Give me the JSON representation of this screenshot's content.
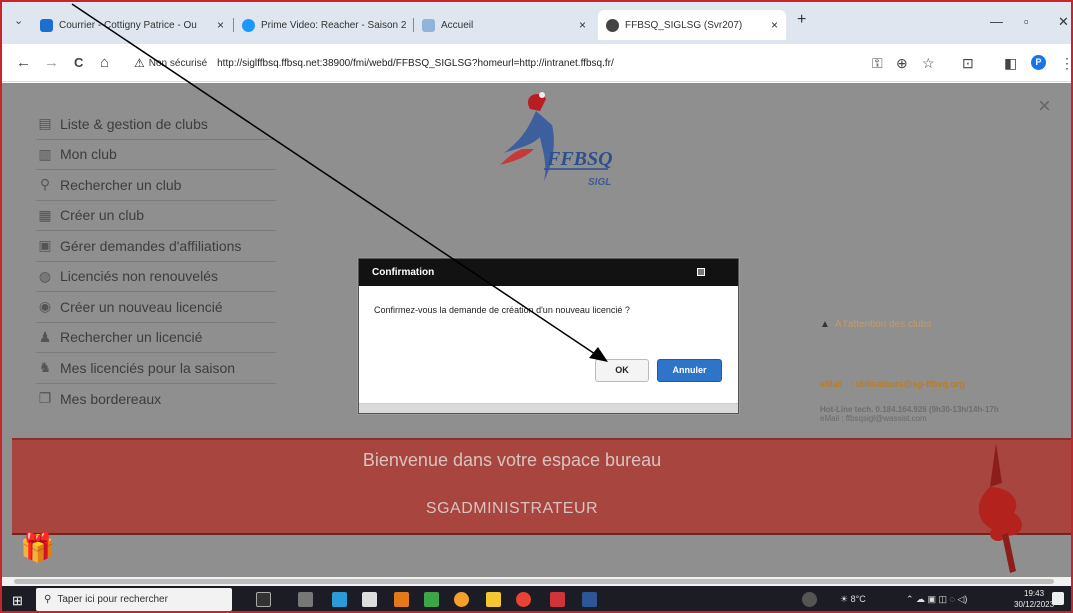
{
  "tabs": [
    {
      "label": "Courrier - Cottigny Patrice - Ou",
      "color": "#1a6fd1"
    },
    {
      "label": "Prime Video: Reacher - Saison 2",
      "color": "#1a98ff"
    },
    {
      "label": "Accueil",
      "color": "#8fb3d9"
    },
    {
      "label": "FFBSQ_SIGLSG (Svr207)",
      "color": "#444444",
      "active": true
    }
  ],
  "tab_close": "×",
  "new_tab": "+",
  "window": {
    "minimize": "—",
    "restore": "▫",
    "close": "✕"
  },
  "address": {
    "security_label": "Non sécurisé",
    "url": "http://siglffbsq.ffbsq.net:38900/fmi/webd/FFBSQ_SIGLSG?homeurl=http://intranet.ffbsq.fr/"
  },
  "nav_icons": {
    "back": "←",
    "forward": "→",
    "reload": "C",
    "home": "⌂",
    "key": "⚿",
    "zoom": "⊕",
    "star": "☆",
    "ext": "⊡",
    "sidebar": "◧",
    "profile": "P",
    "menu": "⋮"
  },
  "menu": [
    {
      "label": "Liste & gestion de clubs",
      "icon": "list-icon"
    },
    {
      "label": "Mon club",
      "icon": "document-icon"
    },
    {
      "label": "Rechercher un club",
      "icon": "search-icon"
    },
    {
      "label": "Créer un club",
      "icon": "document-icon"
    },
    {
      "label": "Gérer demandes d'affiliations",
      "icon": "card-icon"
    },
    {
      "label": "Licenciés non renouvelés",
      "icon": "group-icon"
    },
    {
      "label": "Créer un nouveau licencié",
      "icon": "user-icon"
    },
    {
      "label": "Rechercher un licencié",
      "icon": "user-search-icon"
    },
    {
      "label": "Mes licenciés pour la saison",
      "icon": "users-icon"
    },
    {
      "label": "Mes bordereaux",
      "icon": "copy-icon"
    }
  ],
  "logo": {
    "name": "FFBSQ",
    "sub": "SIGL"
  },
  "page_close": "×",
  "notice": {
    "attention": "A l'attention des clubs",
    "email_label": "eMail",
    "email_value": ": utilisateurs@sg-ffbsq.org",
    "hotline_line1": "Hot-Line tech. 0.184.164.926 (9h30-13h/14h-17h",
    "hotline_line2": "eMail   : ffbsqsigl@wassist.com"
  },
  "banner": {
    "welcome": "Bienvenue dans votre espace bureau",
    "role": "SGADMINISTRATEUR"
  },
  "dialog": {
    "title": "Confirmation",
    "message": "Confirmez-vous la demande de création d'un nouveau licencié ?",
    "ok": "OK",
    "cancel": "Annuler"
  },
  "taskbar": {
    "search_placeholder": "Taper ici pour rechercher",
    "temperature": "8°C",
    "time": "19:43",
    "date": "30/12/2023"
  },
  "colors": {
    "banner": "#a9453f",
    "accent": "#2e74c9",
    "frame": "#c8242c"
  }
}
